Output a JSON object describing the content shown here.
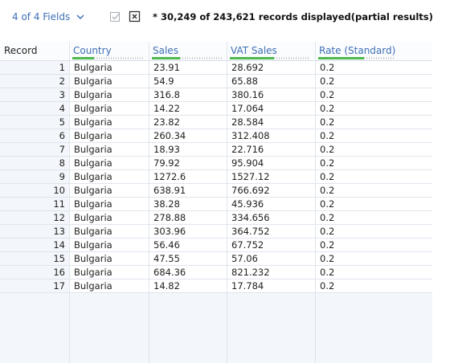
{
  "toolbar": {
    "fields_label": "4 of 4 Fields",
    "status": "* 30,249 of 243,621 records displayed(partial results)"
  },
  "icons": {
    "fields_dropdown": "chevron-down-icon",
    "check": "checkbox-check-icon",
    "close": "close-box-icon"
  },
  "colors": {
    "accent": "#3d6fb6",
    "quality_bar": "#4eb94d",
    "grid_bg": "#f3f6fa",
    "cell_bg": "#ffffff"
  },
  "grid": {
    "record_header": "Record",
    "columns": [
      {
        "name": "Country",
        "quality": 0.3
      },
      {
        "name": "Sales",
        "quality": 0.4
      },
      {
        "name": "VAT Sales",
        "quality": 0.55
      },
      {
        "name": "Rate (Standard)",
        "quality": 0.6
      }
    ],
    "rows": [
      {
        "record": "1",
        "cells": [
          "Bulgaria",
          "23.91",
          "28.692",
          "0.2"
        ]
      },
      {
        "record": "2",
        "cells": [
          "Bulgaria",
          "54.9",
          "65.88",
          "0.2"
        ]
      },
      {
        "record": "3",
        "cells": [
          "Bulgaria",
          "316.8",
          "380.16",
          "0.2"
        ]
      },
      {
        "record": "4",
        "cells": [
          "Bulgaria",
          "14.22",
          "17.064",
          "0.2"
        ]
      },
      {
        "record": "5",
        "cells": [
          "Bulgaria",
          "23.82",
          "28.584",
          "0.2"
        ]
      },
      {
        "record": "6",
        "cells": [
          "Bulgaria",
          "260.34",
          "312.408",
          "0.2"
        ]
      },
      {
        "record": "7",
        "cells": [
          "Bulgaria",
          "18.93",
          "22.716",
          "0.2"
        ]
      },
      {
        "record": "8",
        "cells": [
          "Bulgaria",
          "79.92",
          "95.904",
          "0.2"
        ]
      },
      {
        "record": "9",
        "cells": [
          "Bulgaria",
          "1272.6",
          "1527.12",
          "0.2"
        ]
      },
      {
        "record": "10",
        "cells": [
          "Bulgaria",
          "638.91",
          "766.692",
          "0.2"
        ]
      },
      {
        "record": "11",
        "cells": [
          "Bulgaria",
          "38.28",
          "45.936",
          "0.2"
        ]
      },
      {
        "record": "12",
        "cells": [
          "Bulgaria",
          "278.88",
          "334.656",
          "0.2"
        ]
      },
      {
        "record": "13",
        "cells": [
          "Bulgaria",
          "303.96",
          "364.752",
          "0.2"
        ]
      },
      {
        "record": "14",
        "cells": [
          "Bulgaria",
          "56.46",
          "67.752",
          "0.2"
        ]
      },
      {
        "record": "15",
        "cells": [
          "Bulgaria",
          "47.55",
          "57.06",
          "0.2"
        ]
      },
      {
        "record": "16",
        "cells": [
          "Bulgaria",
          "684.36",
          "821.232",
          "0.2"
        ]
      },
      {
        "record": "17",
        "cells": [
          "Bulgaria",
          "14.82",
          "17.784",
          "0.2"
        ]
      }
    ]
  }
}
